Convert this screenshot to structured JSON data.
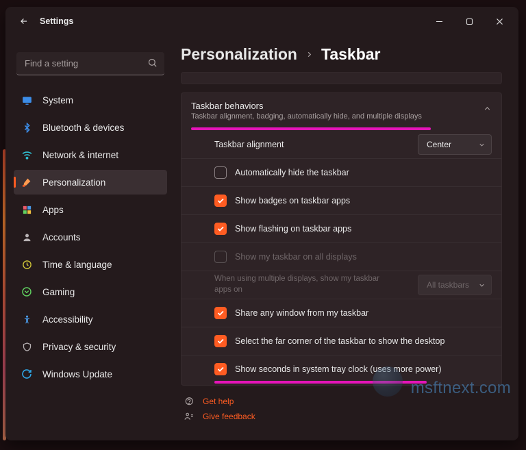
{
  "titlebar": {
    "title": "Settings"
  },
  "sidebar": {
    "search_placeholder": "Find a setting",
    "items": [
      {
        "id": "system",
        "label": "System",
        "icon_color": "#3c8de8"
      },
      {
        "id": "bluetooth",
        "label": "Bluetooth & devices",
        "icon_color": "#3c8de8"
      },
      {
        "id": "network",
        "label": "Network & internet",
        "icon_color": "#2fc0d4"
      },
      {
        "id": "personalization",
        "label": "Personalization",
        "icon_color": "#ff5c22",
        "selected": true
      },
      {
        "id": "apps",
        "label": "Apps",
        "icon_color": "#e85a6a"
      },
      {
        "id": "accounts",
        "label": "Accounts",
        "icon_color": "#b8b2b4"
      },
      {
        "id": "time",
        "label": "Time & language",
        "icon_color": "#d0c638"
      },
      {
        "id": "gaming",
        "label": "Gaming",
        "icon_color": "#60d060"
      },
      {
        "id": "accessibility",
        "label": "Accessibility",
        "icon_color": "#4a9ae8"
      },
      {
        "id": "privacy",
        "label": "Privacy & security",
        "icon_color": "#b8b2b4"
      },
      {
        "id": "update",
        "label": "Windows Update",
        "icon_color": "#2fa8e8"
      }
    ]
  },
  "breadcrumb": {
    "parent": "Personalization",
    "current": "Taskbar"
  },
  "card": {
    "title": "Taskbar behaviors",
    "subtitle": "Taskbar alignment, badging, automatically hide, and multiple displays"
  },
  "options": {
    "alignment_label": "Taskbar alignment",
    "alignment_value": "Center",
    "auto_hide": "Automatically hide the taskbar",
    "badges": "Show badges on taskbar apps",
    "flashing": "Show flashing on taskbar apps",
    "all_displays": "Show my taskbar on all displays",
    "multi_label": "When using multiple displays, show my taskbar apps on",
    "multi_value": "All taskbars",
    "share_window": "Share any window from my taskbar",
    "far_corner": "Select the far corner of the taskbar to show the desktop",
    "show_seconds": "Show seconds in system tray clock (uses more power)"
  },
  "footer": {
    "help": "Get help",
    "feedback": "Give feedback"
  },
  "watermark": "msftnext.com"
}
